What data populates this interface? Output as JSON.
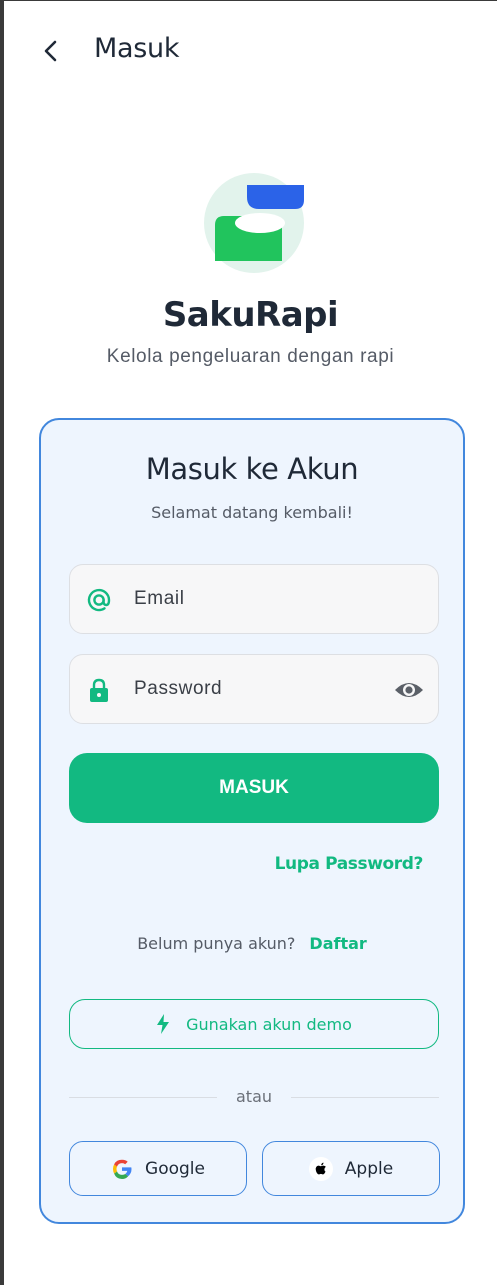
{
  "appbar": {
    "title": "Masuk"
  },
  "brand": {
    "name": "SakuRapi",
    "tagline": "Kelola pengeluaran dengan rapi"
  },
  "card": {
    "title": "Masuk ke Akun",
    "subtitle": "Selamat datang kembali!",
    "email": {
      "value": "",
      "placeholder": "Email",
      "icon": "at-icon"
    },
    "password": {
      "value": "",
      "placeholder": "Password",
      "icon": "lock-icon",
      "toggle_icon": "eye-icon"
    },
    "login_label": "MASUK",
    "forgot_label": "Lupa Password?",
    "signup_prompt": "Belum punya akun?",
    "signup_link": "Daftar",
    "demo_label": "Gunakan akun demo",
    "demo_icon": "lightning-icon",
    "divider_text": "atau",
    "google_label": "Google",
    "apple_label": "Apple"
  },
  "colors": {
    "primary": "#12b981",
    "accent_blue": "#4287dd",
    "card_bg": "#eef5fe",
    "text": "#1f2937"
  }
}
